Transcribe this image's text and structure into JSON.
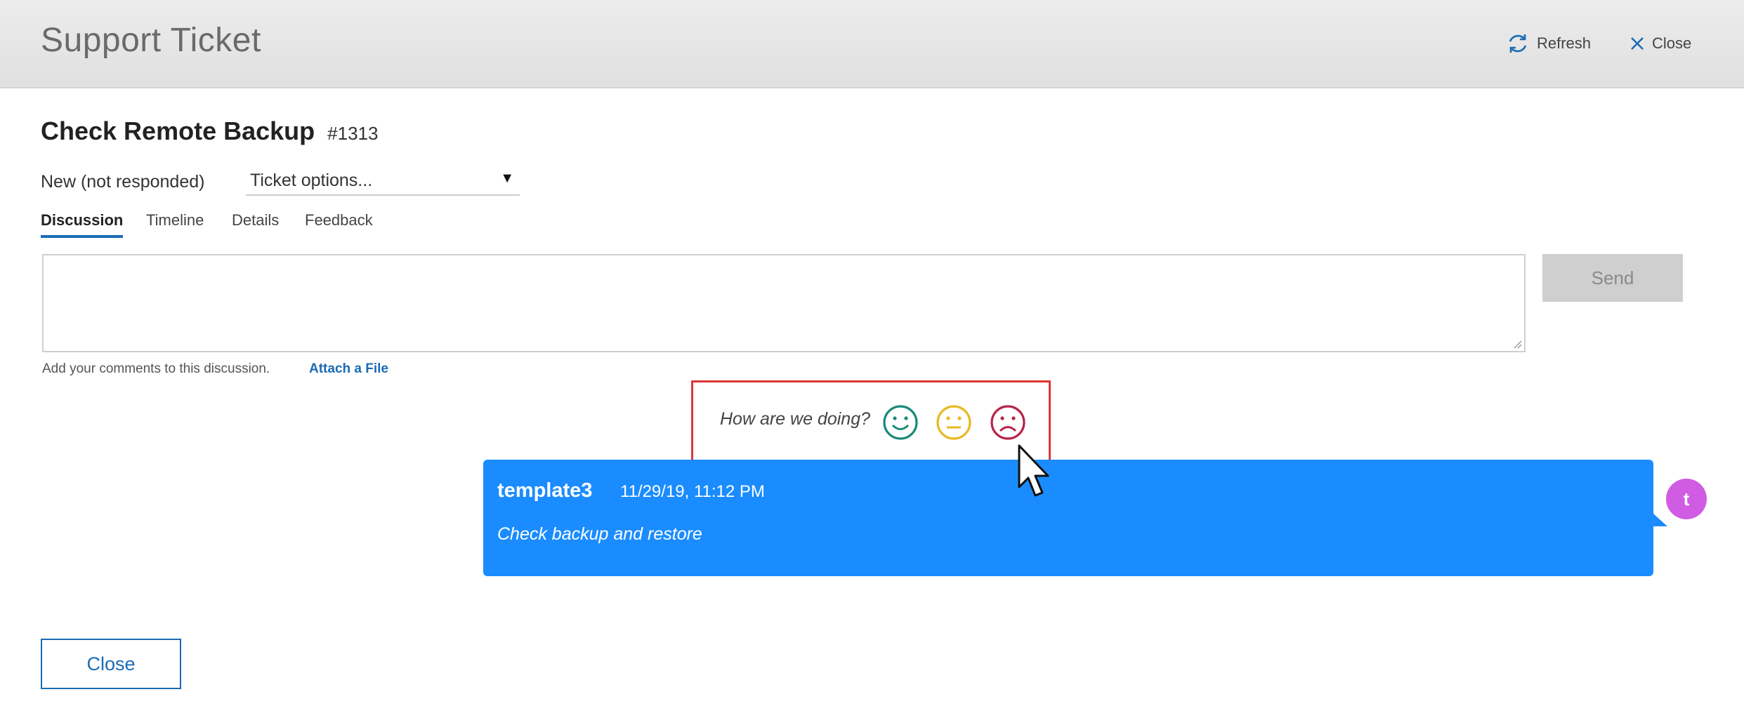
{
  "header": {
    "title": "Support Ticket",
    "refresh_label": "Refresh",
    "close_label": "Close",
    "icons": {
      "refresh": "refresh-icon",
      "close": "close-icon"
    },
    "accent_color": "#1a6bb5"
  },
  "ticket": {
    "title": "Check Remote Backup",
    "number": "#1313",
    "status": "New (not responded)",
    "options_label": "Ticket options..."
  },
  "tabs": [
    {
      "label": "Discussion",
      "active": true
    },
    {
      "label": "Timeline",
      "active": false
    },
    {
      "label": "Details",
      "active": false
    },
    {
      "label": "Feedback",
      "active": false
    }
  ],
  "composer": {
    "value": "",
    "send_label": "Send",
    "helper_text": "Add your comments to this discussion.",
    "attach_label": "Attach a File"
  },
  "feedback": {
    "question": "How are we doing?",
    "faces": [
      {
        "icon": "happy-face-icon",
        "color": "#1a8a7a"
      },
      {
        "icon": "neutral-face-icon",
        "color": "#e8b923"
      },
      {
        "icon": "sad-face-icon",
        "color": "#b8234a"
      }
    ],
    "highlight_color": "#e03535"
  },
  "messages": [
    {
      "author": "template3",
      "timestamp": "11/29/19, 11:12 PM",
      "text": "Check backup and restore",
      "avatar_letter": "t",
      "bubble_color": "#1a8cff",
      "avatar_color": "#d05ce3"
    }
  ],
  "footer": {
    "close_label": "Close"
  }
}
